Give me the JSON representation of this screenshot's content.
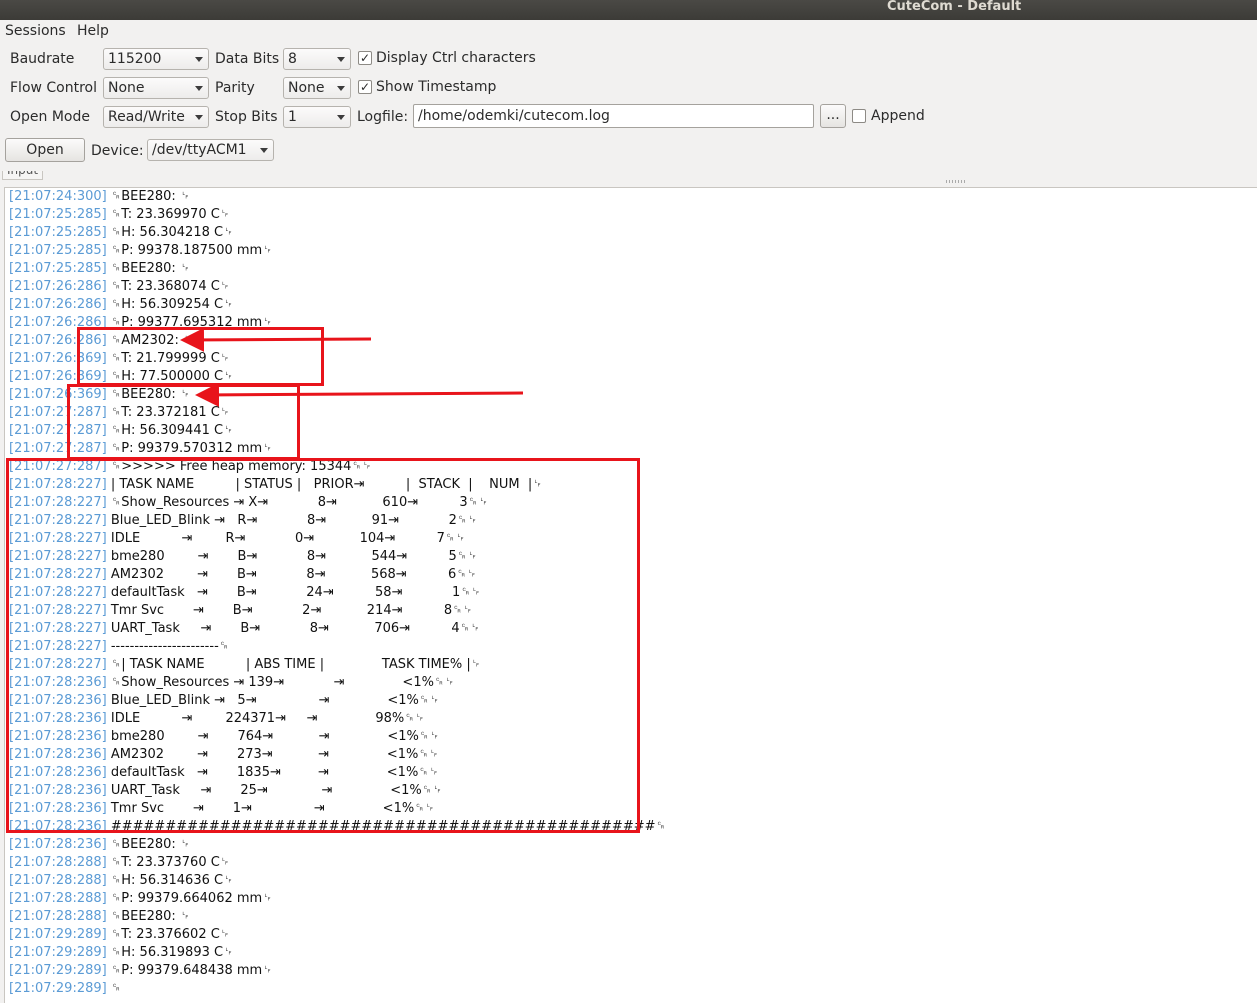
{
  "window": {
    "title": "CuteCom - Default"
  },
  "menubar": {
    "sessions": "Sessions",
    "help": "Help"
  },
  "settings": {
    "baudrate_label": "Baudrate",
    "baudrate_value": "115200",
    "databits_label": "Data Bits",
    "databits_value": "8",
    "display_ctrl_label": "Display Ctrl characters",
    "display_ctrl_checked": true,
    "flow_label": "Flow Control",
    "flow_value": "None",
    "parity_label": "Parity",
    "parity_value": "None",
    "show_ts_label": "Show Timestamp",
    "show_ts_checked": true,
    "openmode_label": "Open Mode",
    "openmode_value": "Read/Write",
    "stopbits_label": "Stop Bits",
    "stopbits_value": "1",
    "logfile_label": "Logfile:",
    "logfile_value": "/home/odemki/cutecom.log",
    "browse_label": "...",
    "append_label": "Append",
    "append_checked": false,
    "open_label": "Open",
    "device_label": "Device:",
    "device_value": "/dev/ttyACM1"
  },
  "tab": {
    "label": "Input"
  },
  "output": {
    "lines": [
      {
        "ts": "[21:07:24:300]",
        "text": " ␍BEE280: ␊"
      },
      {
        "ts": "[21:07:25:285]",
        "text": " ␍T: 23.369970 C␊"
      },
      {
        "ts": "[21:07:25:285]",
        "text": " ␍H: 56.304218 C␊"
      },
      {
        "ts": "[21:07:25:285]",
        "text": " ␍P: 99378.187500 mm␊"
      },
      {
        "ts": "[21:07:25:285]",
        "text": " ␍BEE280: ␊"
      },
      {
        "ts": "[21:07:26:286]",
        "text": " ␍T: 23.368074 C␊"
      },
      {
        "ts": "[21:07:26:286]",
        "text": " ␍H: 56.309254 C␊"
      },
      {
        "ts": "[21:07:26:286]",
        "text": " ␍P: 99377.695312 mm␊"
      },
      {
        "ts": "[21:07:26:286]",
        "text": " ␍AM2302: ␊"
      },
      {
        "ts": "[21:07:26:369]",
        "text": " ␍T: 21.799999 C␊"
      },
      {
        "ts": "[21:07:26:369]",
        "text": " ␍H: 77.500000 C␊"
      },
      {
        "ts": "[21:07:26:369]",
        "text": " ␍BEE280: ␊"
      },
      {
        "ts": "[21:07:27:287]",
        "text": " ␍T: 23.372181 C␊"
      },
      {
        "ts": "[21:07:27:287]",
        "text": " ␍H: 56.309441 C␊"
      },
      {
        "ts": "[21:07:27:287]",
        "text": " ␍P: 99379.570312 mm␊"
      },
      {
        "ts": "[21:07:27:287]",
        "text": " ␍>>>>> Free heap memory: 15344␍␊"
      },
      {
        "ts": "[21:07:28:227]",
        "text": " | TASK NAME          | STATUS |   PRIOR⇥          |  STACK  |    NUM  |␊"
      },
      {
        "ts": "[21:07:28:227]",
        "text": " ␍Show_Resources ⇥ X⇥            8⇥           610⇥          3␍␊"
      },
      {
        "ts": "[21:07:28:227]",
        "text": " Blue_LED_Blink ⇥   R⇥            8⇥           91⇥            2␍␊"
      },
      {
        "ts": "[21:07:28:227]",
        "text": " IDLE          ⇥        R⇥            0⇥           104⇥          7␍␊"
      },
      {
        "ts": "[21:07:28:227]",
        "text": " bme280        ⇥       B⇥            8⇥           544⇥          5␍␊"
      },
      {
        "ts": "[21:07:28:227]",
        "text": " AM2302        ⇥       B⇥            8⇥           568⇥          6␍␊"
      },
      {
        "ts": "[21:07:28:227]",
        "text": " defaultTask   ⇥       B⇥            24⇥          58⇥            1␍␊"
      },
      {
        "ts": "[21:07:28:227]",
        "text": " Tmr Svc       ⇥       B⇥            2⇥           214⇥          8␍␊"
      },
      {
        "ts": "[21:07:28:227]",
        "text": " UART_Task     ⇥       B⇥            8⇥           706⇥          4␍␊"
      },
      {
        "ts": "[21:07:28:227]",
        "text": " -----------------------␍"
      },
      {
        "ts": "[21:07:28:227]",
        "text": " ␍| TASK NAME          | ABS TIME |              TASK TIME% |␊"
      },
      {
        "ts": "[21:07:28:236]",
        "text": " ␍Show_Resources ⇥ 139⇥            ⇥              <1%␍␊"
      },
      {
        "ts": "[21:07:28:236]",
        "text": " Blue_LED_Blink ⇥   5⇥               ⇥              <1%␍␊"
      },
      {
        "ts": "[21:07:28:236]",
        "text": " IDLE          ⇥        224371⇥     ⇥              98%␍␊"
      },
      {
        "ts": "[21:07:28:236]",
        "text": " bme280        ⇥       764⇥           ⇥              <1%␍␊"
      },
      {
        "ts": "[21:07:28:236]",
        "text": " AM2302        ⇥       273⇥           ⇥              <1%␍␊"
      },
      {
        "ts": "[21:07:28:236]",
        "text": " defaultTask   ⇥       1835⇥         ⇥              <1%␍␊"
      },
      {
        "ts": "[21:07:28:236]",
        "text": " UART_Task     ⇥       25⇥             ⇥              <1%␍␊"
      },
      {
        "ts": "[21:07:28:236]",
        "text": " Tmr Svc       ⇥       1⇥               ⇥              <1%␍␊"
      },
      {
        "ts": "[21:07:28:236]",
        "text": " ##################################################␍"
      },
      {
        "ts": "[21:07:28:236]",
        "text": " ␍BEE280: ␊"
      },
      {
        "ts": "[21:07:28:288]",
        "text": " ␍T: 23.373760 C␊"
      },
      {
        "ts": "[21:07:28:288]",
        "text": " ␍H: 56.314636 C␊"
      },
      {
        "ts": "[21:07:28:288]",
        "text": " ␍P: 99379.664062 mm␊"
      },
      {
        "ts": "[21:07:28:288]",
        "text": " ␍BEE280: ␊"
      },
      {
        "ts": "[21:07:29:289]",
        "text": " ␍T: 23.376602 C␊"
      },
      {
        "ts": "[21:07:29:289]",
        "text": " ␍H: 56.319893 C␊"
      },
      {
        "ts": "[21:07:29:289]",
        "text": " ␍P: 99379.648438 mm␊"
      },
      {
        "ts": "[21:07:29:289]",
        "text": " ␍"
      }
    ]
  },
  "annotations": {
    "highlight_color": "#e8141b"
  }
}
